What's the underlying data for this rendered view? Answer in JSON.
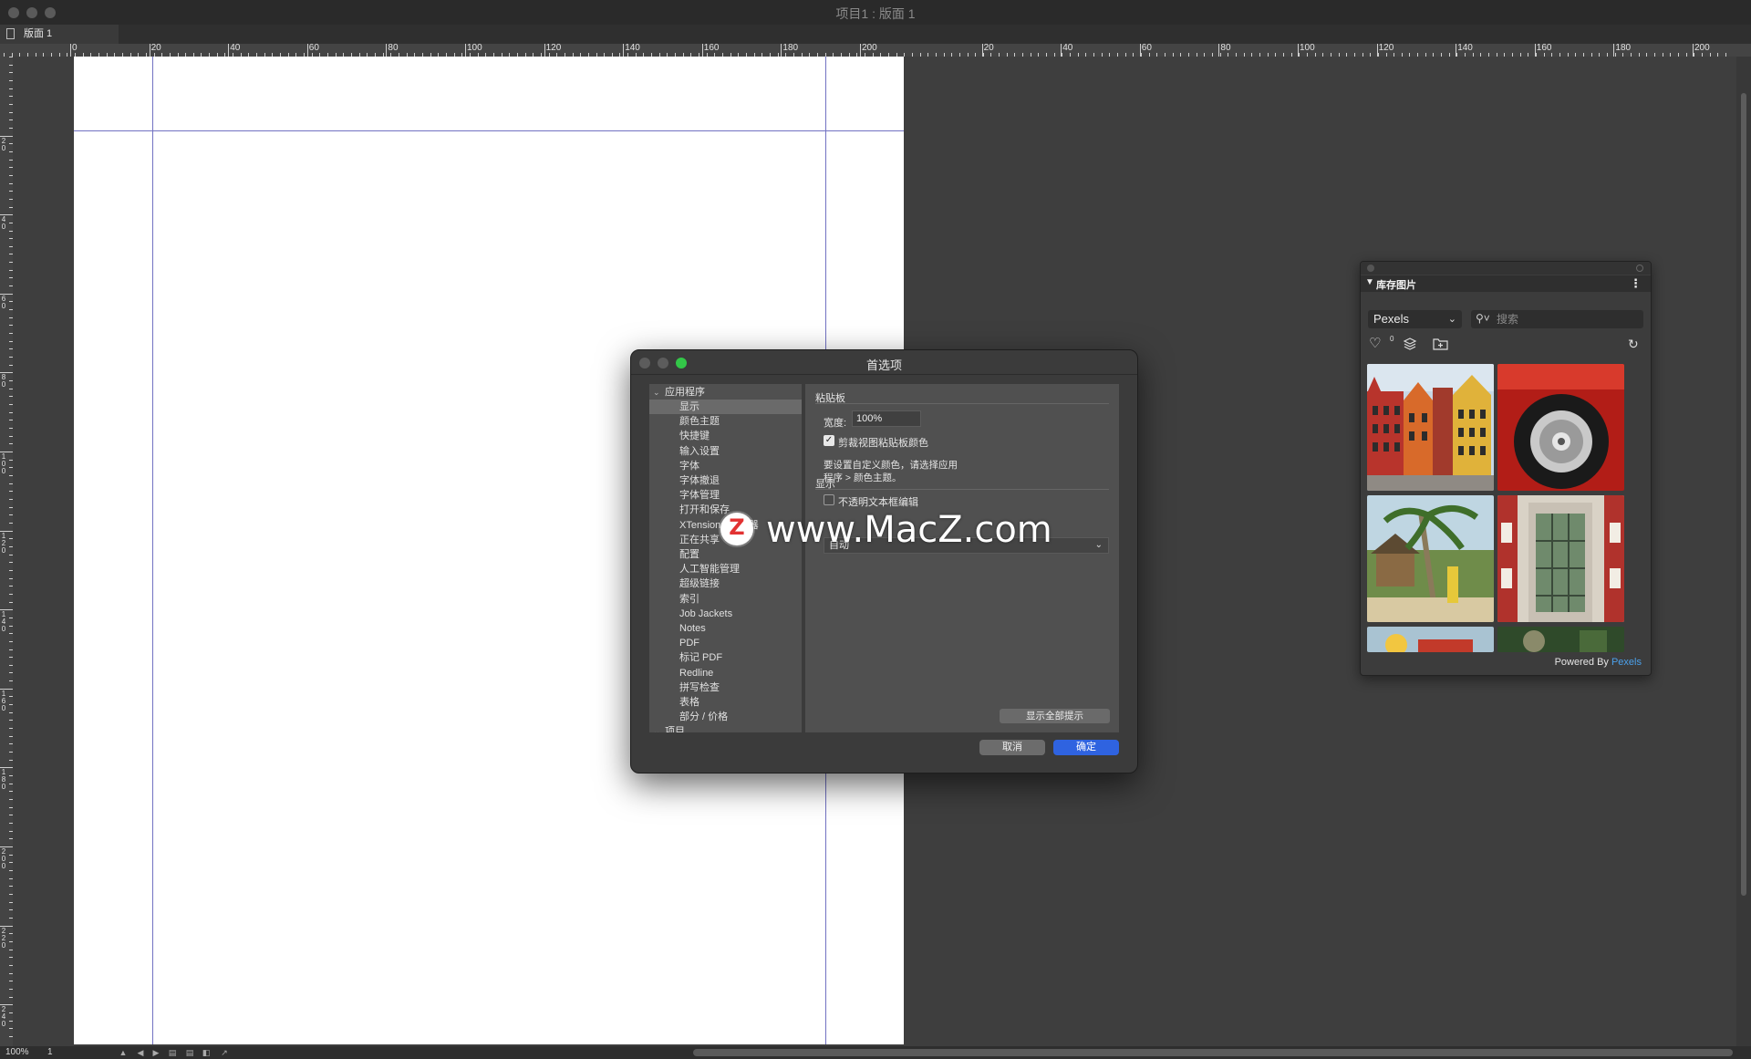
{
  "window": {
    "title": "项目1 : 版面 1"
  },
  "layout_tab": {
    "label": "版面 1"
  },
  "ruler": {
    "top_labels_page": [
      "0",
      "20",
      "40",
      "60",
      "80",
      "100",
      "120",
      "140",
      "160",
      "180",
      "200"
    ],
    "top_labels_spread": [
      "20",
      "40",
      "60",
      "80",
      "100",
      "120",
      "140",
      "160",
      "180",
      "200"
    ],
    "left_labels": [
      "20",
      "40",
      "60",
      "80",
      "100",
      "120",
      "140",
      "160",
      "180",
      "200",
      "220",
      "240"
    ]
  },
  "preferences": {
    "title": "首选项",
    "nav": {
      "section_app": "应用程序",
      "items": [
        "显示",
        "颜色主题",
        "快捷键",
        "输入设置",
        "字体",
        "字体撤退",
        "字体管理",
        "打开和保存",
        "XTensions 管理器",
        "正在共享",
        "配置",
        "人工智能管理",
        "超级链接",
        "索引",
        "Job Jackets",
        "Notes",
        "PDF",
        "标记 PDF",
        "Redline",
        "拼写检查",
        "表格",
        "部分 / 价格"
      ],
      "selected": "显示",
      "section_project": "项目"
    },
    "pasteboard": {
      "section_title": "粘贴板",
      "width_label": "宽度:",
      "width_value": "100%",
      "clip_label": "剪裁视图粘贴板颜色",
      "clip_checked": true,
      "hint": "要设置自定义颜色，请选择应用程序 > 颜色主题。"
    },
    "display": {
      "section_title": "显示",
      "opaque_label": "不透明文本框编辑",
      "opaque_checked": false,
      "mode_value": "自动"
    },
    "show_all_tips": "显示全部提示",
    "cancel": "取消",
    "ok": "确定"
  },
  "watermark": {
    "badge": "Z",
    "text": "www.MacZ.com"
  },
  "stock_panel": {
    "title": "库存图片",
    "source": "Pexels",
    "search_placeholder": "搜索",
    "favorites_count": "0",
    "footer_prefix": "Powered By ",
    "footer_brand": "Pexels",
    "images": [
      "colorful-buildings-photo",
      "red-car-wheel-photo",
      "palm-beach-hut-photo",
      "building-facade-photo",
      "partial-photo-1",
      "partial-photo-2"
    ]
  },
  "statusbar": {
    "zoom": "100%",
    "page": "1"
  },
  "colors": {
    "accent": "#2f63e0",
    "guide": "#7272c2",
    "brand_link": "#4ba0ea"
  }
}
